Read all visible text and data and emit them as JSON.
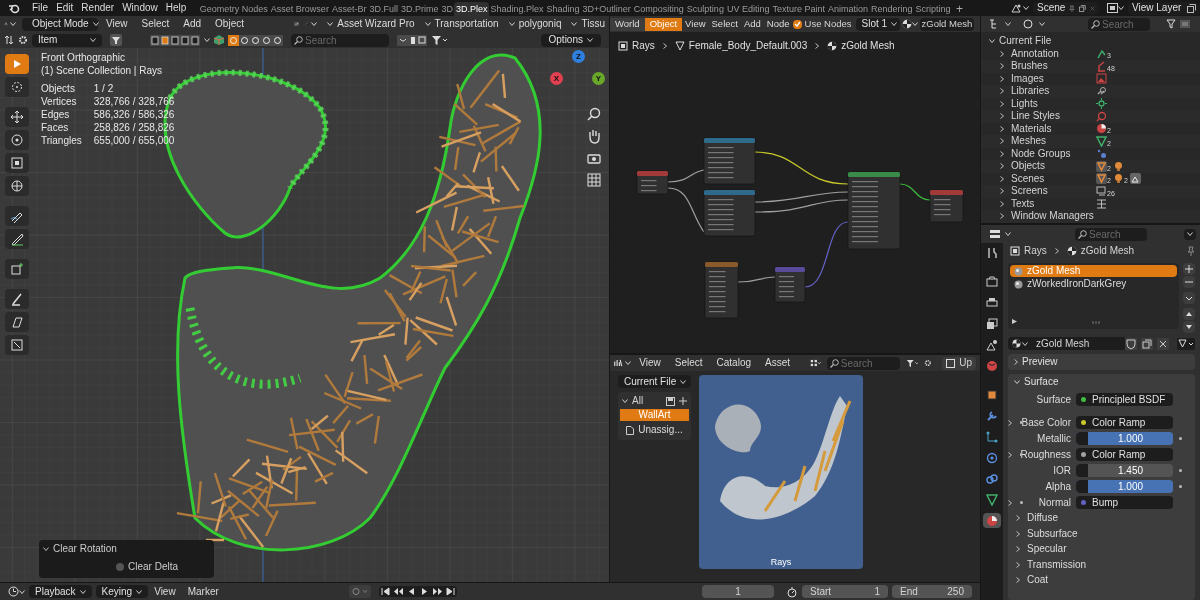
{
  "topbar": {
    "menus": [
      "File",
      "Edit",
      "Render",
      "Window",
      "Help"
    ],
    "workspaces": [
      {
        "label": "Geometry Nodes",
        "selected": false
      },
      {
        "label": "Asset Browser",
        "selected": false
      },
      {
        "label": "Asset-Br",
        "selected": false
      },
      {
        "label": "3D.Full",
        "selected": false
      },
      {
        "label": "3D.Prime",
        "selected": false
      },
      {
        "label": "3D",
        "selected": false
      },
      {
        "label": "3D.Plex",
        "selected": true
      },
      {
        "label": "Shading.Plex",
        "selected": false
      },
      {
        "label": "Shading",
        "selected": false
      },
      {
        "label": "3D+Outliner",
        "selected": false
      },
      {
        "label": "Compositing",
        "selected": false
      },
      {
        "label": "Sculpting",
        "selected": false
      },
      {
        "label": "UV Editing",
        "selected": false
      },
      {
        "label": "Texture Paint",
        "selected": false
      },
      {
        "label": "Animation",
        "selected": false
      },
      {
        "label": "Rendering",
        "selected": false
      },
      {
        "label": "Scripting",
        "selected": false
      }
    ],
    "add_tab": "+",
    "scene": "Scene",
    "view_layer": "View Layer"
  },
  "viewport": {
    "mode": "Object Mode",
    "menus": [
      "View",
      "Select",
      "Add",
      "Object"
    ],
    "addons": [
      "Asset Wizard Pro",
      "Transportation",
      "polygoniq",
      "Tissu"
    ],
    "transform_space": "Item",
    "search_placeholder": "Search",
    "options": "Options",
    "tools": [
      {
        "kind": "select",
        "selected": true
      },
      {
        "kind": "cursor",
        "selected": false
      },
      {
        "kind": "move",
        "selected": false
      },
      {
        "kind": "rotate",
        "selected": false
      },
      {
        "kind": "scale",
        "selected": false
      },
      {
        "kind": "transform",
        "selected": false
      },
      {
        "kind": "annotate",
        "selected": false
      },
      {
        "kind": "measure",
        "selected": false
      },
      {
        "kind": "add_cube",
        "selected": false
      },
      {
        "kind": "paint",
        "selected": false
      },
      {
        "kind": "shear",
        "selected": false
      },
      {
        "kind": "shrink",
        "selected": false
      }
    ],
    "view_name": "Front Orthographic",
    "collection": "(1) Scene Collection | Rays",
    "stats": [
      {
        "label": "Objects",
        "value": "1 / 2"
      },
      {
        "label": "Vertices",
        "value": "328,766 / 328,766"
      },
      {
        "label": "Edges",
        "value": "586,326 / 586,326"
      },
      {
        "label": "Faces",
        "value": "258,826 / 258,826"
      },
      {
        "label": "Triangles",
        "value": "655,000 / 655,000"
      }
    ],
    "gizmo_axes": [
      {
        "label": "Z",
        "color": "#2f7fe0"
      },
      {
        "label": "X",
        "color": "#e0404f"
      },
      {
        "label": "Y",
        "color": "#6aa82a"
      }
    ],
    "last_operator": {
      "title": "Clear Rotation",
      "expanded": true,
      "options": [
        {
          "label": "Clear Delta",
          "checked": false
        }
      ]
    }
  },
  "timeline": {
    "menus": [
      "Playback",
      "Keying",
      "View",
      "Marker"
    ],
    "current_frame": "1",
    "start_label": "Start",
    "start": "1",
    "end_label": "End",
    "end": "250"
  },
  "node_editor": {
    "tabs": [
      {
        "label": "World",
        "selected": false
      },
      {
        "label": "Object",
        "selected": true
      }
    ],
    "menus": [
      "View",
      "Select",
      "Add",
      "Node"
    ],
    "use_nodes": {
      "label": "Use Nodes",
      "checked": true
    },
    "slot": "Slot 1",
    "material": "zGold Mesh",
    "breadcrumbs": [
      "Rays",
      "Female_Body_Default.003",
      "zGold Mesh"
    ]
  },
  "asset_browser": {
    "menus": [
      "View",
      "Select",
      "Catalog",
      "Asset"
    ],
    "search_placeholder": "Search",
    "cut_button": "Up",
    "library": "Current File",
    "catalog_root": {
      "label": "All",
      "expanded": true
    },
    "catalogs": [
      {
        "label": "WallArt",
        "selected": true
      },
      {
        "label": "Unassig...",
        "selected": false
      }
    ],
    "assets": [
      {
        "name": "Rays"
      }
    ]
  },
  "outliner": {
    "search_placeholder": "Search",
    "root": {
      "label": "Current File",
      "expanded": true
    },
    "items": [
      {
        "label": "Annotation",
        "icons": [
          {
            "kind": "annotation",
            "count": "3"
          }
        ]
      },
      {
        "label": "Brushes",
        "icons": [
          {
            "kind": "brush",
            "count": "48"
          }
        ]
      },
      {
        "label": "Images",
        "icons": [
          {
            "kind": "image"
          }
        ]
      },
      {
        "label": "Libraries",
        "icons": [
          {
            "kind": "link"
          }
        ]
      },
      {
        "label": "Lights",
        "icons": [
          {
            "kind": "light"
          }
        ]
      },
      {
        "label": "Line Styles",
        "icons": [
          {
            "kind": "linestyle"
          }
        ]
      },
      {
        "label": "Materials",
        "icons": [
          {
            "kind": "material",
            "count": "2"
          }
        ]
      },
      {
        "label": "Meshes",
        "icons": [
          {
            "kind": "mesh",
            "count": "2"
          }
        ]
      },
      {
        "label": "Node Groups",
        "icons": [
          {
            "kind": "nodes"
          }
        ]
      },
      {
        "label": "Objects",
        "icons": [
          {
            "kind": "object_mesh",
            "count": "2"
          },
          {
            "kind": "object_light"
          }
        ]
      },
      {
        "label": "Scenes",
        "icons": [
          {
            "kind": "object_mesh",
            "count": "2"
          },
          {
            "kind": "object_light",
            "count": "2"
          },
          {
            "kind": "scene"
          }
        ]
      },
      {
        "label": "Screens",
        "icons": [
          {
            "kind": "screen",
            "count": "26"
          }
        ]
      },
      {
        "label": "Texts",
        "icons": [
          {
            "kind": "text"
          }
        ]
      },
      {
        "label": "Window Managers"
      }
    ]
  },
  "properties": {
    "search_placeholder": "Search",
    "breadcrumbs": [
      "Rays",
      "zGold Mesh"
    ],
    "tabs": [
      {
        "kind": "tool",
        "selected": false
      },
      {
        "kind": "render",
        "selected": false
      },
      {
        "kind": "output",
        "selected": false
      },
      {
        "kind": "view_layer",
        "selected": false
      },
      {
        "kind": "scene",
        "selected": false
      },
      {
        "kind": "world",
        "selected": false
      },
      {
        "kind": "object",
        "selected": false
      },
      {
        "kind": "modifiers",
        "selected": false
      },
      {
        "kind": "particles",
        "selected": false
      },
      {
        "kind": "physics",
        "selected": false
      },
      {
        "kind": "constraints",
        "selected": false
      },
      {
        "kind": "data",
        "selected": false
      },
      {
        "kind": "material",
        "selected": true
      }
    ],
    "material_slots": [
      {
        "label": "zGold Mesh",
        "selected": true
      },
      {
        "label": "zWorkedIronDarkGrey",
        "selected": false
      }
    ],
    "material": "zGold Mesh",
    "panels": [
      {
        "label": "Preview",
        "expanded": false
      },
      {
        "label": "Surface",
        "expanded": true
      }
    ],
    "surface_rows": [
      {
        "kind": "link",
        "label": "Surface",
        "value": "Principled BSDF",
        "color": "#3fbf3f",
        "expandable": false
      },
      {
        "kind": "link",
        "label": "Base Color",
        "value": "Color Ramp",
        "color": "#c7c729",
        "expandable": true
      },
      {
        "kind": "slider",
        "label": "Metallic",
        "value": "1.000",
        "level": 1
      },
      {
        "kind": "link",
        "label": "Roughness",
        "value": "Color Ramp",
        "color": "#a1a1a1",
        "expandable": true
      },
      {
        "kind": "slider",
        "label": "IOR",
        "value": "1.450"
      },
      {
        "kind": "slider",
        "label": "Alpha",
        "value": "1.000",
        "level": 1
      },
      {
        "kind": "link",
        "label": "Normal",
        "value": "Bump",
        "color": "#6363c7",
        "expandable": true
      }
    ],
    "subpanels": [
      "Diffuse",
      "Subsurface",
      "Specular",
      "Transmission",
      "Coat"
    ]
  }
}
